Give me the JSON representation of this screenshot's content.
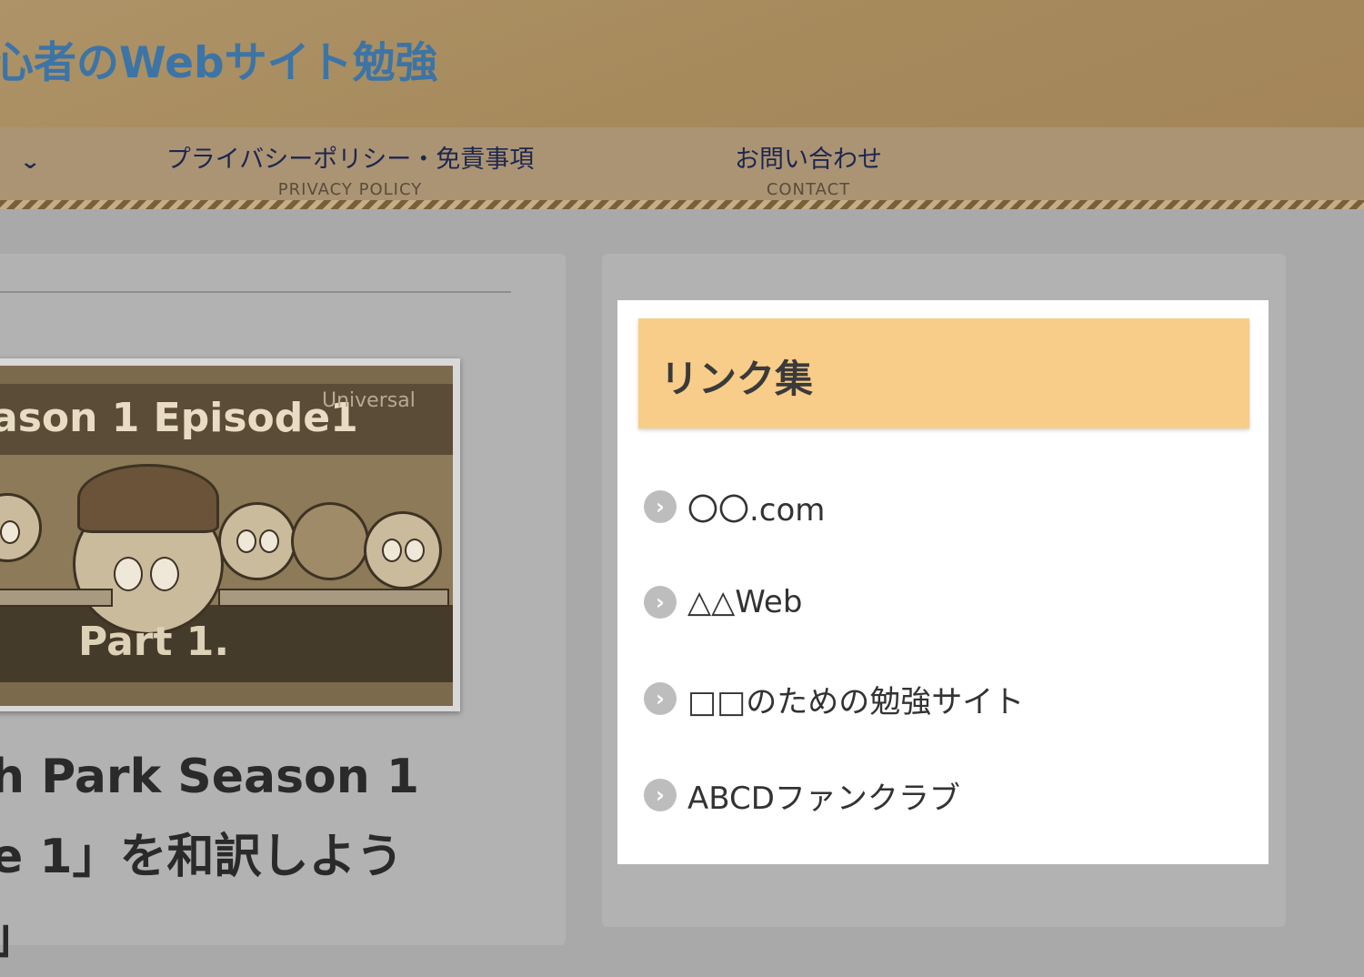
{
  "header": {
    "site_title": "心者のWebサイト勉強"
  },
  "nav": {
    "items": [
      {
        "label": "プライバシーポリシー・免責事項",
        "sub": "PRIVACY POLICY"
      },
      {
        "label": "お問い合わせ",
        "sub": "CONTACT"
      }
    ]
  },
  "thumbnail": {
    "episode_text": "ason 1 Episode1",
    "universal_text": "Universal",
    "part_text": "Part 1."
  },
  "post": {
    "title_lines": [
      "h Park Season 1",
      "e 1」を和訳しよう",
      "」"
    ]
  },
  "sidebar": {
    "widget_title": "リンク集",
    "links": [
      {
        "label": "〇〇.com"
      },
      {
        "label": "△△Web"
      },
      {
        "label": "□□のための勉強サイト"
      },
      {
        "label": "ABCDファンクラブ"
      }
    ]
  },
  "colors": {
    "header_bg": "#a68a5c",
    "title_color": "#3d74a6",
    "nav_bg": "#ab9474",
    "widget_title_bg": "#f8cd89"
  }
}
